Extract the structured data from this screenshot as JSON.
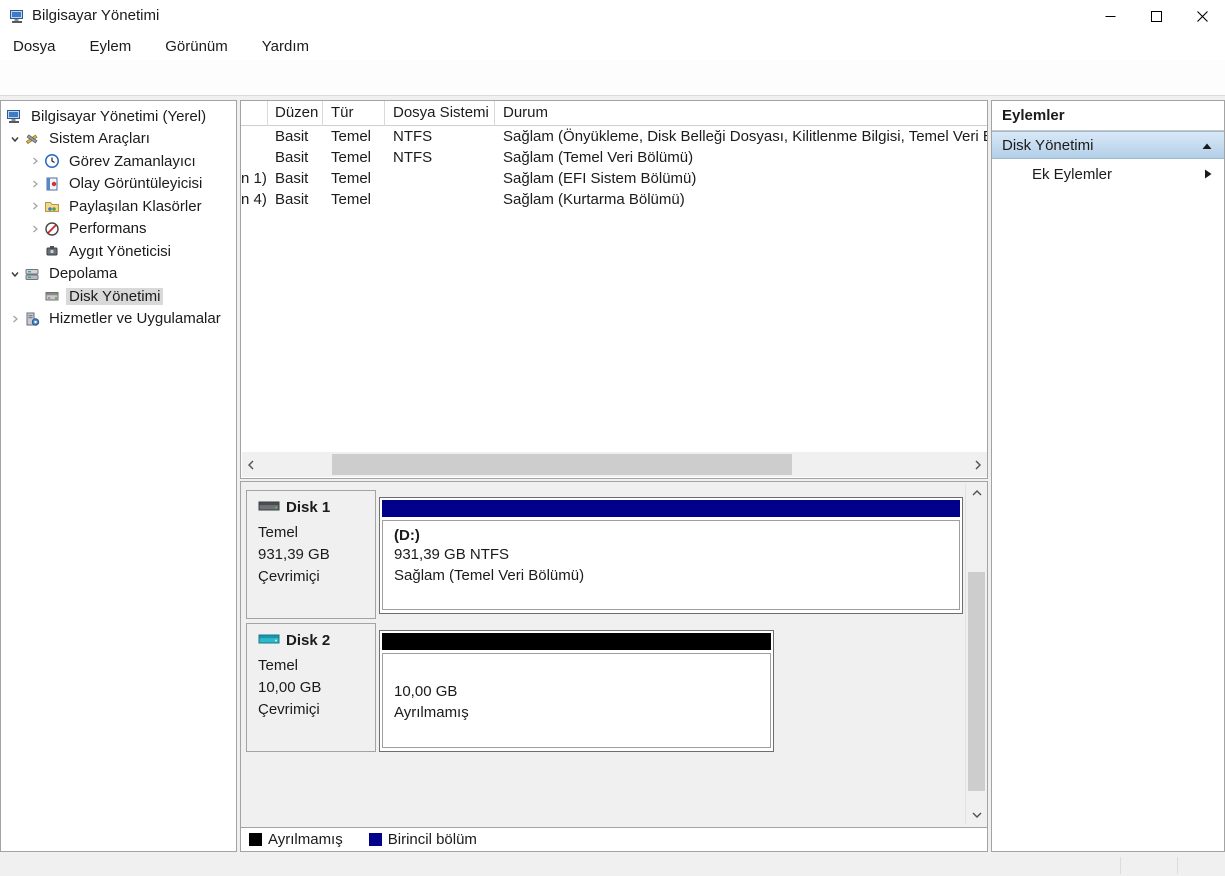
{
  "window": {
    "title": "Bilgisayar Yönetimi"
  },
  "menu": {
    "items": [
      {
        "label": "Dosya"
      },
      {
        "label": "Eylem"
      },
      {
        "label": "Görünüm"
      },
      {
        "label": "Yardım"
      }
    ]
  },
  "toolbar": {
    "icons": [
      "back-icon",
      "forward-icon",
      "export-list-icon",
      "console-tree-toggle-icon",
      "help-icon",
      "action-pane-toggle-icon",
      "disk-properties-icon",
      "delete-icon",
      "check-document-icon",
      "folder-up-icon",
      "folder-search-icon",
      "list-options-icon"
    ]
  },
  "tree": {
    "items": [
      {
        "label": "Bilgisayar Yönetimi (Yerel)",
        "chevron": "none",
        "icon": "computer-icon",
        "selected": false
      },
      {
        "label": "Sistem Araçları",
        "chevron": "expanded",
        "icon": "system-tools-icon",
        "selected": false
      },
      {
        "label": "Görev Zamanlayıcı",
        "chevron": "collapsed",
        "icon": "task-scheduler-icon",
        "selected": false
      },
      {
        "label": "Olay Görüntüleyicisi",
        "chevron": "collapsed",
        "icon": "event-viewer-icon",
        "selected": false
      },
      {
        "label": "Paylaşılan Klasörler",
        "chevron": "collapsed",
        "icon": "shared-folders-icon",
        "selected": false
      },
      {
        "label": "Performans",
        "chevron": "collapsed",
        "icon": "performance-icon",
        "selected": false
      },
      {
        "label": "Aygıt Yöneticisi",
        "chevron": "none",
        "icon": "device-manager-icon",
        "selected": false
      },
      {
        "label": "Depolama",
        "chevron": "expanded",
        "icon": "storage-icon",
        "selected": false
      },
      {
        "label": "Disk Yönetimi",
        "chevron": "none",
        "icon": "disk-management-icon",
        "selected": true
      },
      {
        "label": "Hizmetler ve Uygulamalar",
        "chevron": "collapsed",
        "icon": "services-icon",
        "selected": false
      }
    ]
  },
  "volume_list": {
    "columns": {
      "c0": "",
      "c1": "Düzen",
      "c2": "Tür",
      "c3": "Dosya Sistemi",
      "c4": "Durum"
    },
    "rows": [
      {
        "volume": "",
        "layout": "Basit",
        "type": "Temel",
        "fs": "NTFS",
        "status": "Sağlam (Önyükleme, Disk Belleği Dosyası, Kilitlenme Bilgisi, Temel Veri B"
      },
      {
        "volume": "",
        "layout": "Basit",
        "type": "Temel",
        "fs": "NTFS",
        "status": "Sağlam (Temel Veri Bölümü)"
      },
      {
        "volume": "n 1)",
        "layout": "Basit",
        "type": "Temel",
        "fs": "",
        "status": "Sağlam (EFI Sistem Bölümü)"
      },
      {
        "volume": "n 4)",
        "layout": "Basit",
        "type": "Temel",
        "fs": "",
        "status": "Sağlam (Kurtarma Bölümü)"
      }
    ]
  },
  "disks": [
    {
      "name": "Disk 1",
      "type": "Temel",
      "size": "931,39 GB",
      "status": "Çevrimiçi",
      "partition": {
        "title": "(D:)",
        "line1": "931,39 GB NTFS",
        "line2": "Sağlam (Temel Veri Bölümü)",
        "color": "#00008b"
      }
    },
    {
      "name": "Disk 2",
      "type": "Temel",
      "size": "10,00 GB",
      "status": "Çevrimiçi",
      "partition": {
        "title": "",
        "line1": "10,00 GB",
        "line2": "Ayrılmamış",
        "color": "#000000"
      }
    }
  ],
  "legend": {
    "items": [
      {
        "label": "Ayrılmamış",
        "color": "#000000"
      },
      {
        "label": "Birincil bölüm",
        "color": "#00008b"
      }
    ]
  },
  "actions": {
    "title": "Eylemler",
    "group": "Disk Yönetimi",
    "items": [
      {
        "label": "Ek Eylemler"
      }
    ]
  }
}
